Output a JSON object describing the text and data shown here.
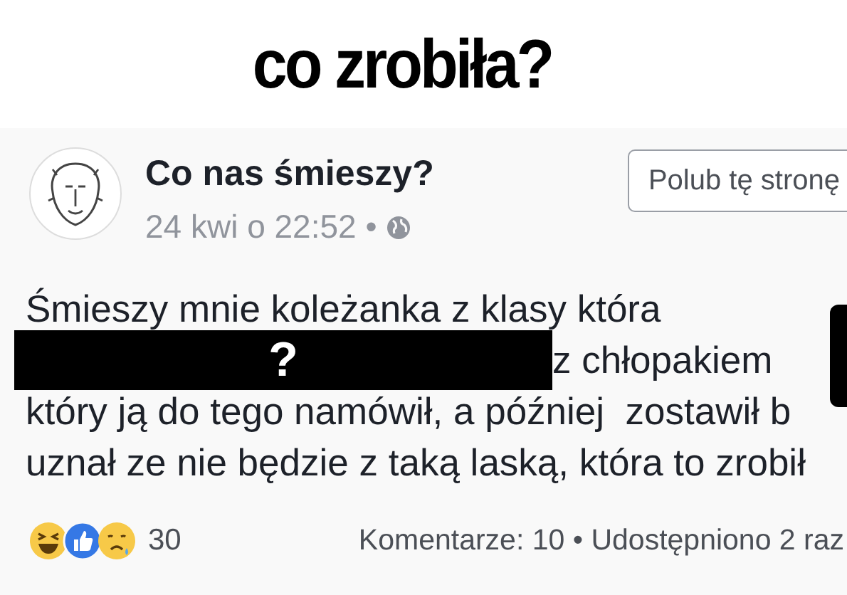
{
  "caption": "co zrobiła?",
  "post": {
    "page_name": "Co nas śmieszy?",
    "timestamp": "24 kwi o 22:52 •",
    "like_page_button": "Polub tę stronę",
    "lines": [
      {
        "kind": "text",
        "text": "Śmieszy mnie koleżanka z klasy która"
      },
      {
        "kind": "redacted",
        "mark": "?",
        "text": "z chłopakiem"
      },
      {
        "kind": "text",
        "text": "który ją do tego namówił, a później  zostawił b"
      },
      {
        "kind": "text",
        "text": "uznał ze nie będzie z taką laską, która to zrobił"
      }
    ],
    "reaction_count": "30",
    "stats": "Komentarze: 10 • Udostępniono 2 raz"
  }
}
